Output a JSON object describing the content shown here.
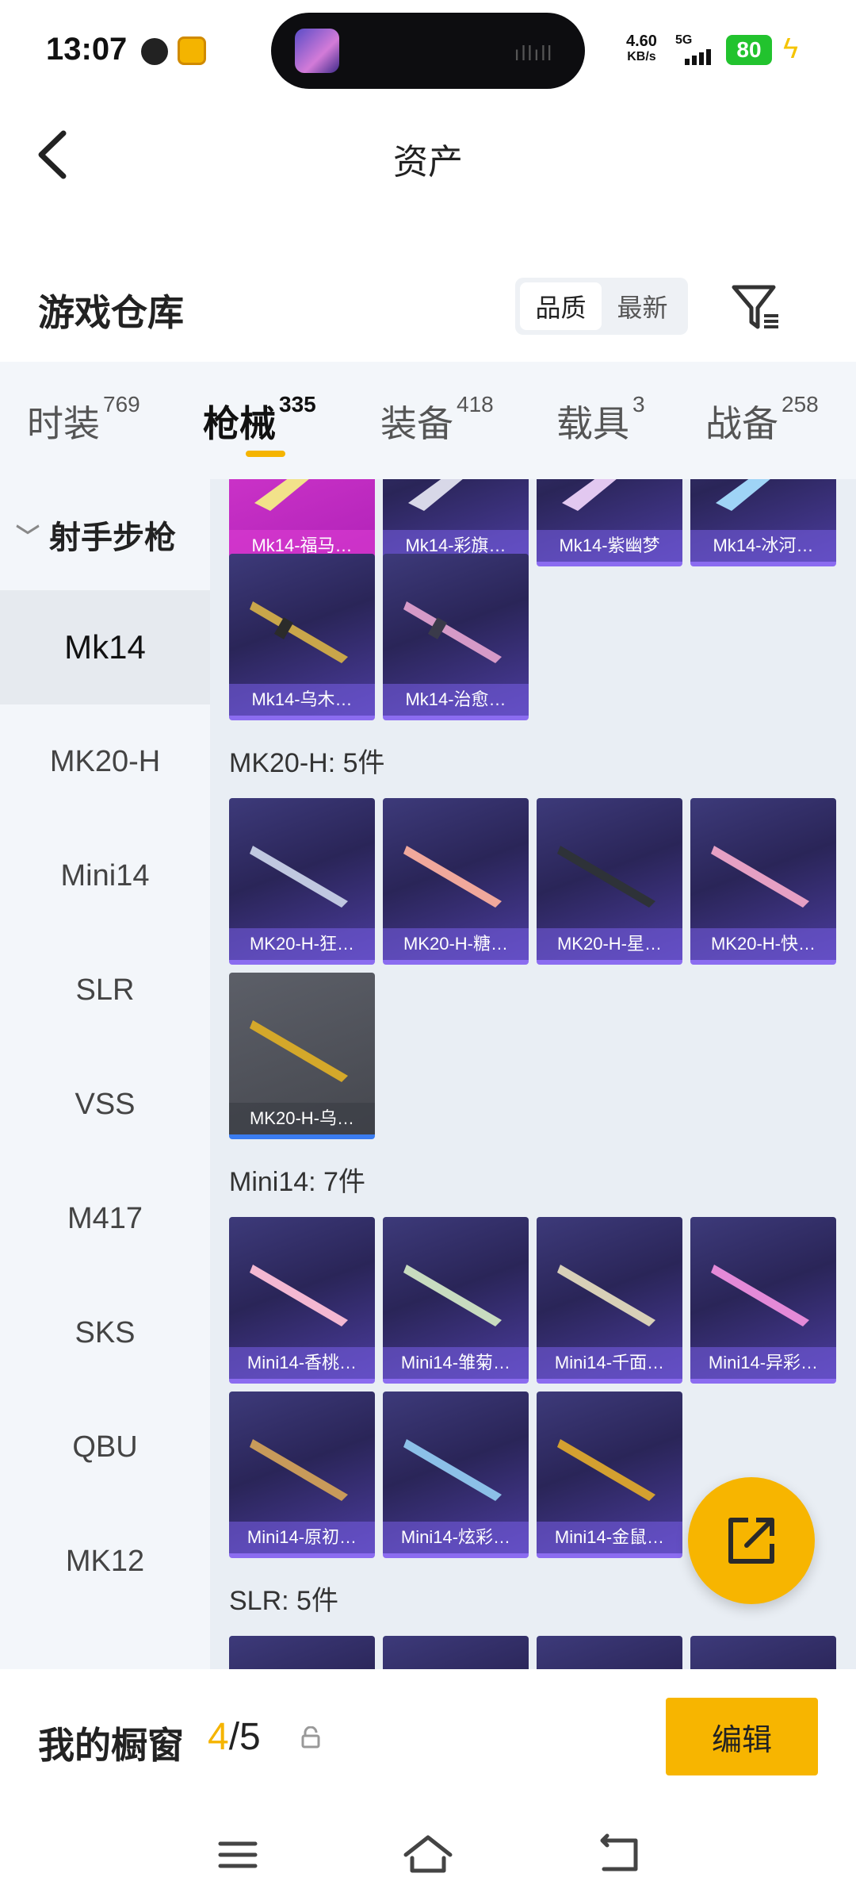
{
  "status_bar": {
    "time": "13:07",
    "net_speed_value": "4.60",
    "net_speed_unit": "KB/s",
    "network": "5G",
    "battery": "80"
  },
  "header": {
    "title": "资产"
  },
  "warehouse": {
    "title": "游戏仓库",
    "sort_options": [
      "品质",
      "最新"
    ],
    "sort_selected": "品质"
  },
  "tabs": [
    {
      "label": "时装",
      "count": "769"
    },
    {
      "label": "枪械",
      "count": "335"
    },
    {
      "label": "装备",
      "count": "418"
    },
    {
      "label": "载具",
      "count": "3"
    },
    {
      "label": "战备",
      "count": "258"
    }
  ],
  "active_tab": "枪械",
  "category_group": "射手步枪",
  "categories": [
    "Mk14",
    "MK20-H",
    "Mini14",
    "SLR",
    "VSS",
    "M417",
    "SKS",
    "QBU",
    "MK12"
  ],
  "active_category": "Mk14",
  "sections": [
    {
      "title": "",
      "items": [
        "Mk14-福马…",
        "Mk14-彩旗…",
        "Mk14-紫幽梦",
        "Mk14-冰河…",
        "Mk14-乌木…",
        "Mk14-治愈…"
      ]
    },
    {
      "title": "MK20-H: 5件",
      "items": [
        "MK20-H-狂…",
        "MK20-H-糖…",
        "MK20-H-星…",
        "MK20-H-快…",
        "MK20-H-乌…"
      ]
    },
    {
      "title": "Mini14: 7件",
      "items": [
        "Mini14-香桃…",
        "Mini14-雏菊…",
        "Mini14-千面…",
        "Mini14-异彩…",
        "Mini14-原初…",
        "Mini14-炫彩…",
        "Mini14-金鼠…"
      ]
    },
    {
      "title": "SLR: 5件",
      "items": []
    }
  ],
  "showcase": {
    "label": "我的橱窗",
    "current": "4",
    "total": "/5",
    "edit_label": "编辑"
  },
  "colors": {
    "accent": "#f7b500",
    "card_purple": "#2a2558",
    "card_pink": "#b022b8",
    "card_grey": "#45474e"
  }
}
